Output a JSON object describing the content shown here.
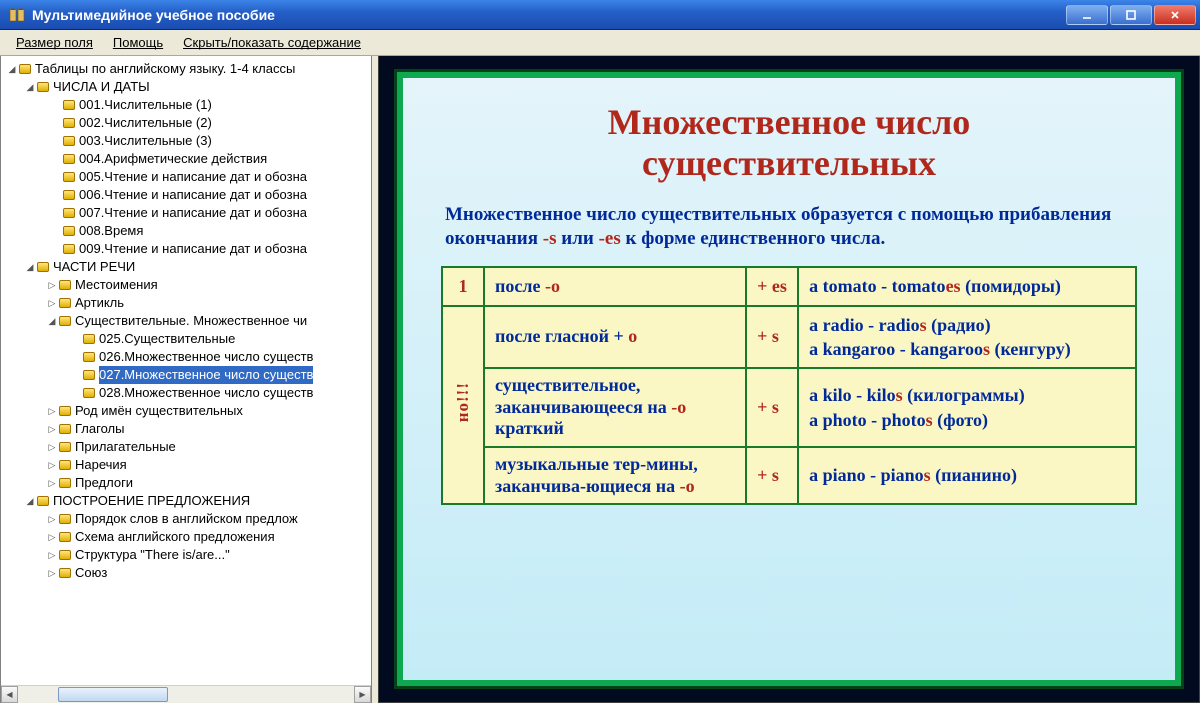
{
  "window": {
    "title": "Мультимедийное учебное пособие"
  },
  "menu": {
    "item1": "Размер поля",
    "item2": "Помощь",
    "item3": "Скрыть/показать содержание"
  },
  "tree": {
    "root": "Таблицы по английскому языку. 1-4 классы",
    "cat1": "ЧИСЛА И ДАТЫ",
    "c1": {
      "a": "001.Числительные (1)",
      "b": "002.Числительные (2)",
      "c": "003.Числительные (3)",
      "d": "004.Арифметические действия",
      "e": "005.Чтение и написание дат и обозна",
      "f": "006.Чтение и написание дат и обозна",
      "g": "007.Чтение и написание дат и обозна",
      "h": "008.Время",
      "i": "009.Чтение и написание дат и обозна"
    },
    "cat2": "ЧАСТИ РЕЧИ",
    "c2": {
      "a": "Местоимения",
      "b": "Артикль",
      "c": "Существительные. Множественное чи",
      "c1": "025.Существительные",
      "c2": "026.Множественное число существ",
      "c3": "027.Множественное число существ",
      "c4": "028.Множественное число существ",
      "d": "Род имён существительных",
      "e": "Глаголы",
      "f": "Прилагательные",
      "g": "Наречия",
      "h": "Предлоги"
    },
    "cat3": "ПОСТРОЕНИЕ ПРЕДЛОЖЕНИЯ",
    "c3": {
      "a": "Порядок слов в английском предлож",
      "b": "Схема английского предложения",
      "c": "Структура \"There is/are...\"",
      "d": "Союз"
    }
  },
  "slide": {
    "title_l1": "Множественное число",
    "title_l2": "существительных",
    "desc_p1": "Множественное число существительных образуется с помощью прибавления окончания ",
    "desc_s1": "-s",
    "desc_or": " или ",
    "desc_s2": "-es",
    "desc_p2": " к форме единственного числа.",
    "num1": "1",
    "vert": "но!!!",
    "row1_rule_a": "после ",
    "row1_rule_b": "-o",
    "row1_end": "+ es",
    "row1_ex_a": "a tomato - tomato",
    "row1_ex_b": "es",
    "row1_ex_c": " (помидоры)",
    "row2_rule_a": "после гласной + ",
    "row2_rule_b": "o",
    "row2_end": "+ s",
    "row2_ex_a": "a radio - radio",
    "row2_ex_s1": "s",
    "row2_ex_b": " (радио)",
    "row2_ex_c": "a kangaroo - kangaroo",
    "row2_ex_s2": "s",
    "row2_ex_d": " (кенгуру)",
    "row3_rule_a": "существительное, заканчивающееся на ",
    "row3_rule_b": "-o",
    "row3_rule_c": " краткий",
    "row3_end": "+ s",
    "row3_ex_a": "a kilo - kilo",
    "row3_ex_s1": "s",
    "row3_ex_b": " (килограммы)",
    "row3_ex_c": "a photo - photo",
    "row3_ex_s2": "s",
    "row3_ex_d": " (фото)",
    "row4_rule_a": "музыкальные тер-мины, заканчива-ющиеся на ",
    "row4_rule_b": "-o",
    "row4_end": "+ s",
    "row4_ex_a": "a piano - piano",
    "row4_ex_s1": "s",
    "row4_ex_b": " (пианино)"
  }
}
